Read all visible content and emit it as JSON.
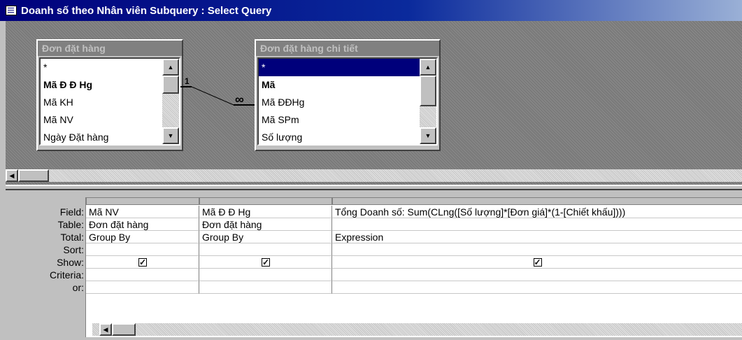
{
  "window": {
    "title": "Doanh số theo Nhân viên Subquery : Select Query"
  },
  "tables": [
    {
      "name": "Đơn đặt hàng",
      "fields": [
        "*",
        "Mã Đ Đ Hg",
        "Mã KH",
        "Mã NV",
        "Ngày Đặt hàng"
      ],
      "bold_field": 1
    },
    {
      "name": "Đơn đặt hàng chi tiết",
      "fields": [
        "*",
        "Mã",
        "Mã ĐĐHg",
        "Mã SPm",
        "Số lượng"
      ],
      "bold_field": 1,
      "selected_field": 0
    }
  ],
  "relationship": {
    "one_label": "1",
    "many_label": "∞"
  },
  "grid": {
    "row_labels": [
      "Field:",
      "Table:",
      "Total:",
      "Sort:",
      "Show:",
      "Criteria:",
      "or:"
    ],
    "columns": [
      {
        "field": "Mã NV",
        "table": "Đơn đặt hàng",
        "total": "Group By",
        "show": true
      },
      {
        "field": "Mã Đ Đ Hg",
        "table": "Đơn đặt hàng",
        "total": "Group By",
        "show": true
      },
      {
        "field": "Tổng Doanh số: Sum(CLng([Số lượng]*[Đơn giá]*(1-[Chiết khấu])))",
        "table": "",
        "total": "Expression",
        "show": true
      }
    ]
  }
}
